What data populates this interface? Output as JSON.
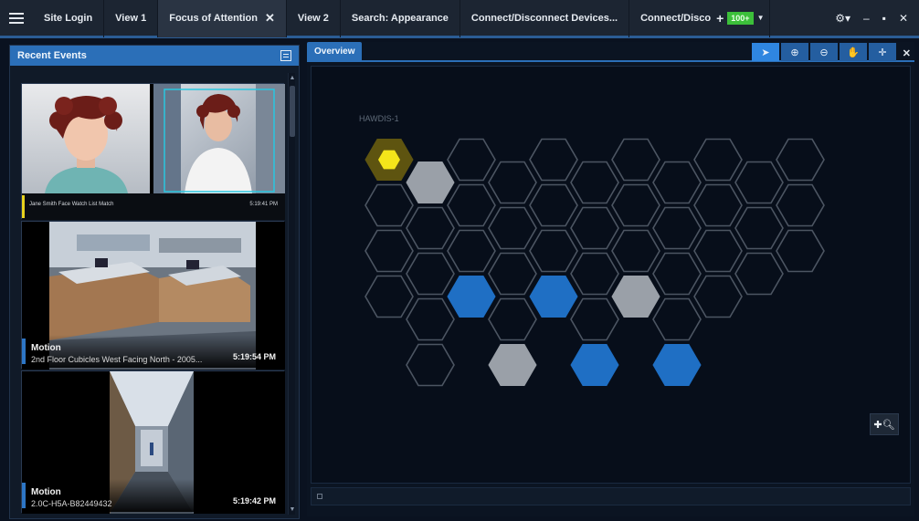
{
  "topbar": {
    "tabs": [
      {
        "label": "Site Login"
      },
      {
        "label": "View 1"
      },
      {
        "label": "Focus of Attention",
        "active": true,
        "closable": true
      },
      {
        "label": "View 2"
      },
      {
        "label": "Search: Appearance"
      },
      {
        "label": "Connect/Disconnect Devices..."
      },
      {
        "label": "Connect/Disco"
      }
    ],
    "status_value": "100+",
    "icons": [
      "menu-icon",
      "add-tab-icon",
      "gear-icon",
      "minimize-icon",
      "maximize-icon",
      "close-icon"
    ]
  },
  "left_panel": {
    "title": "Recent Events",
    "events": [
      {
        "type": "face-match",
        "subtitle": "Jane Smith Face Watch List Match",
        "time": "5:19:41 PM",
        "color": "#e8d21d"
      },
      {
        "title": "Motion",
        "subtitle": "2nd Floor Cubicles West Facing North - 2005...",
        "time": "5:19:54 PM",
        "color": "#2d76c6"
      },
      {
        "title": "Motion",
        "subtitle": "2.0C-H5A-B82449432",
        "time": "5:19:42 PM",
        "color": "#2d76c6"
      }
    ]
  },
  "right_panel": {
    "tab": "Overview",
    "map_label": "HAWDIS-1",
    "tools": [
      "pointer-icon",
      "zoom-in-icon",
      "zoom-out-icon",
      "pan-icon",
      "center-icon"
    ],
    "hex_states": {
      "alert": "#5e5410",
      "alert_dot": "#f4e51a",
      "inactive": "#9aa0a8",
      "active": "#1f6fc4",
      "outline": "#4c5562"
    }
  }
}
